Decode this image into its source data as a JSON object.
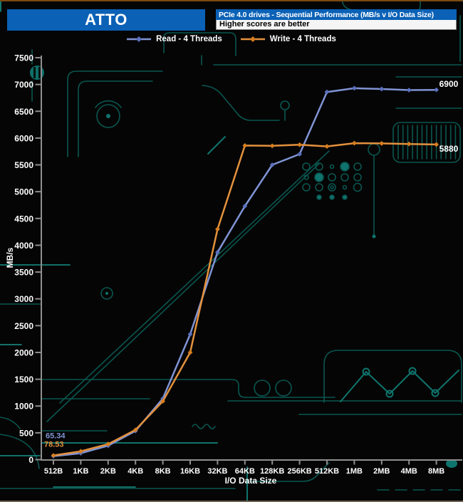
{
  "header": {
    "app_title": "ATTO",
    "chart_title": "PCIe 4.0 drives - Sequential Performance (MB/s v I/O Data Size)",
    "chart_subtitle": "Higher scores are better"
  },
  "legend": [
    {
      "label": "Read - 4 Threads",
      "color": "#8094d4",
      "marker_color": "#5b72c0"
    },
    {
      "label": "Write - 4 Threads",
      "color": "#e3913d",
      "marker_color": "#d97f1f"
    }
  ],
  "colors": {
    "background": "#050505",
    "header_blue": "#0a61b6",
    "axis_gray": "#8f8f8f",
    "text_white": "#ffffff",
    "circuit_teal": "#0f746d"
  },
  "chart_data": {
    "type": "line",
    "title": "PCIe 4.0 drives - Sequential Performance (MB/s v I/O Data Size)",
    "subtitle": "Higher scores are better",
    "xlabel": "I/O Data Size",
    "ylabel": "MB/s",
    "ylim": [
      0,
      7500
    ],
    "yticks": [
      0,
      500,
      1000,
      1500,
      2000,
      2500,
      3000,
      3500,
      4000,
      4500,
      5000,
      5500,
      6000,
      6500,
      7000,
      7500
    ],
    "grid": false,
    "legend_position": "top",
    "categories": [
      "512B",
      "1KB",
      "2KB",
      "4KB",
      "8KB",
      "16KB",
      "32KB",
      "64KB",
      "128KB",
      "256KB",
      "512KB",
      "1MB",
      "2MB",
      "4MB",
      "8MB"
    ],
    "series": [
      {
        "name": "Read - 4 Threads",
        "color": "#8094d4",
        "marker_color": "#5b72c0",
        "values": [
          65.34,
          120,
          260,
          535,
          1140,
          2340,
          3870,
          4730,
          5500,
          5700,
          6860,
          6930,
          6915,
          6895,
          6900
        ]
      },
      {
        "name": "Write - 4 Threads",
        "color": "#e3913d",
        "marker_color": "#d97f1f",
        "values": [
          78.53,
          155,
          290,
          555,
          1090,
          2000,
          4300,
          5860,
          5855,
          5875,
          5845,
          5905,
          5900,
          5890,
          5880
        ]
      }
    ],
    "annotations": [
      {
        "text": "65.34",
        "series": 0,
        "point": "first",
        "color": "#8094d4"
      },
      {
        "text": "78.53",
        "series": 1,
        "point": "first",
        "color": "#e3913d"
      },
      {
        "text": "6900",
        "series": 0,
        "point": "last",
        "color": "#ffffff"
      },
      {
        "text": "5880",
        "series": 1,
        "point": "last",
        "color": "#ffffff"
      }
    ]
  }
}
